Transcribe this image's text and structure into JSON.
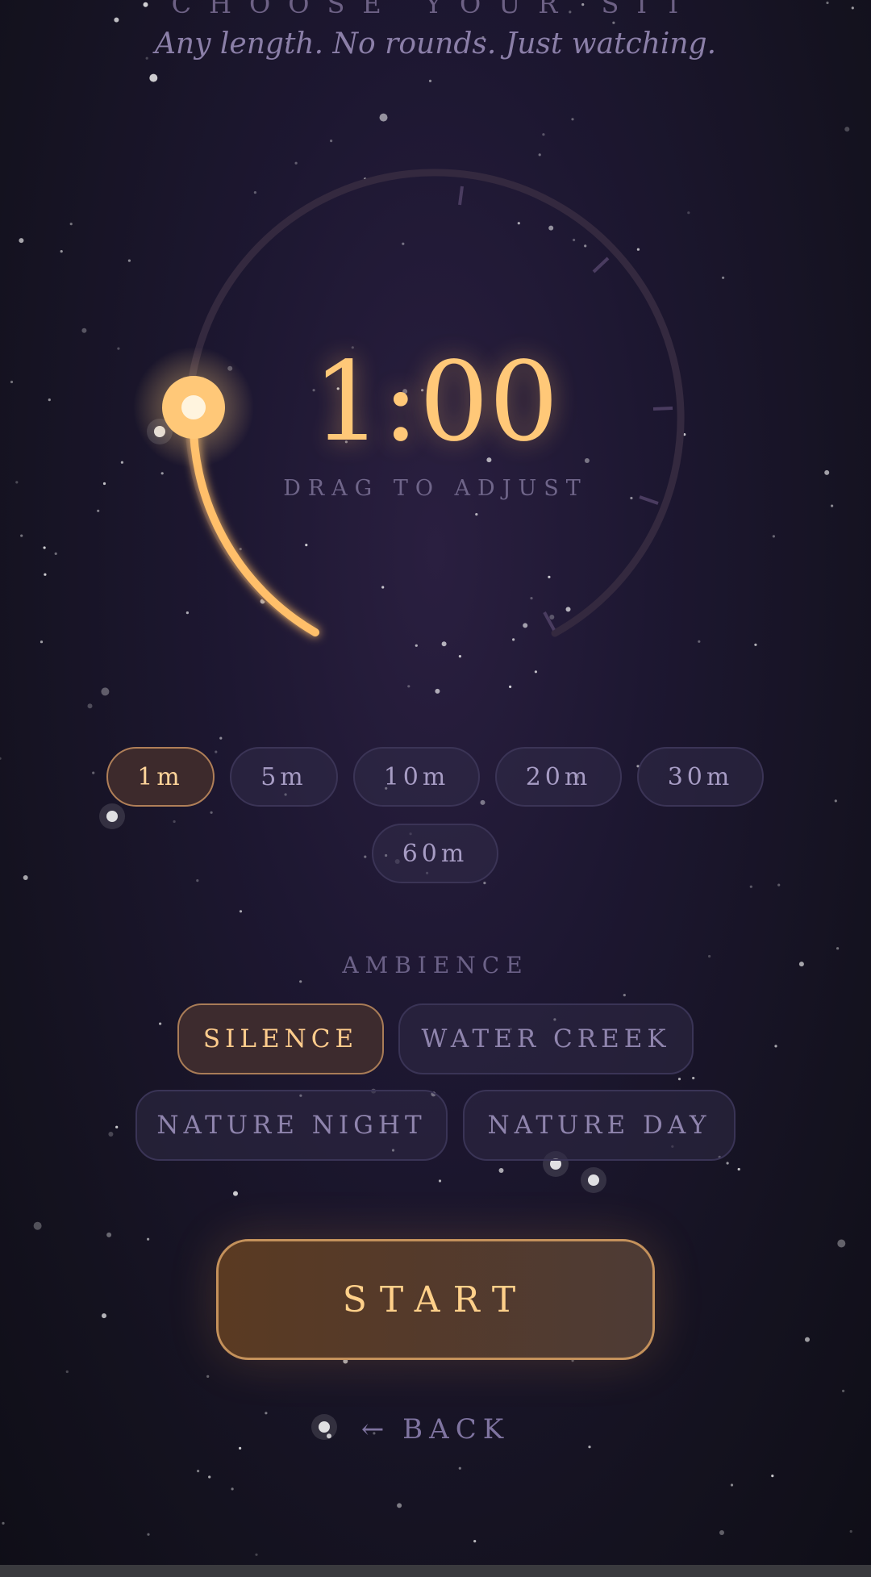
{
  "header": {
    "title": "CHOOSE YOUR SIT",
    "subtitle": "Any length. No rounds. Just watching."
  },
  "timer": {
    "display": "1:00",
    "hint": "DRAG TO ADJUST",
    "value_minutes": 1,
    "max_minutes": 60
  },
  "durations": [
    {
      "label": "1m",
      "active": true
    },
    {
      "label": "5m",
      "active": false
    },
    {
      "label": "10m",
      "active": false
    },
    {
      "label": "20m",
      "active": false
    },
    {
      "label": "30m",
      "active": false
    },
    {
      "label": "60m",
      "active": false
    }
  ],
  "ambience": {
    "label": "AMBIENCE",
    "options": [
      {
        "label": "SILENCE",
        "active": true
      },
      {
        "label": "WATER CREEK",
        "active": false
      },
      {
        "label": "NATURE NIGHT",
        "active": false
      },
      {
        "label": "NATURE DAY",
        "active": false
      }
    ]
  },
  "actions": {
    "start_label": "START",
    "back_arrow": "←",
    "back_label": "BACK"
  },
  "colors": {
    "accent": "#ffc878",
    "background": "#1d1731",
    "chip_border": "#3b3456",
    "text_muted": "#8b7fa8"
  }
}
